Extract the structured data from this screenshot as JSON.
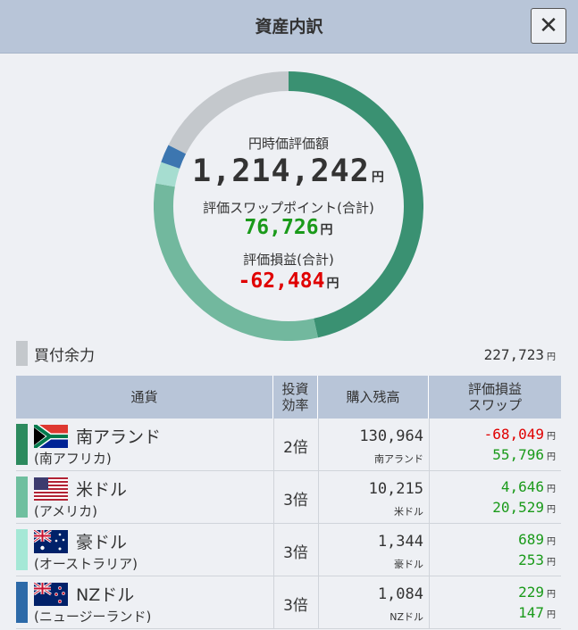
{
  "header": {
    "title": "資産内訳",
    "close_label": "✕"
  },
  "summary": {
    "valuation_label": "円時価評価額",
    "valuation_value": "1,214,242",
    "swap_label": "評価スワップポイント(合計)",
    "swap_value": "76,726",
    "pl_label": "評価損益(合計)",
    "pl_value": "-62,484",
    "unit": "円"
  },
  "chart_data": {
    "type": "pie",
    "categories": [
      "南アランド",
      "米ドル",
      "豪ドル",
      "NZドル",
      "買付余力"
    ],
    "values": [
      46.5,
      31.2,
      2.6,
      2.2,
      17.5
    ],
    "colors": [
      "#3a9172",
      "#72b89e",
      "#a6ddd0",
      "#3c76b0",
      "#c4c8cc"
    ]
  },
  "buying_power": {
    "label": "買付余力",
    "value": "227,723",
    "unit": "円"
  },
  "table": {
    "headers": {
      "currency": "通貨",
      "leverage_1": "投資",
      "leverage_2": "効率",
      "balance": "購入残高",
      "pl_1": "評価損益",
      "pl_2": "スワップ"
    },
    "rows": [
      {
        "color": "#2c8a5e",
        "flag": "za-flag-icon",
        "name": "南アランド",
        "country": "(南アフリカ)",
        "leverage": "2倍",
        "balance": "130,964",
        "balance_unit": "南アランド",
        "pl": "-68,049",
        "swap": "55,796",
        "unit": "円"
      },
      {
        "color": "#6fbf9f",
        "flag": "us-flag-icon",
        "name": "米ドル",
        "country": "(アメリカ)",
        "leverage": "3倍",
        "balance": "10,215",
        "balance_unit": "米ドル",
        "pl": "4,646",
        "swap": "20,529",
        "unit": "円"
      },
      {
        "color": "#a5e8d6",
        "flag": "au-flag-icon",
        "name": "豪ドル",
        "country": "(オーストラリア)",
        "leverage": "3倍",
        "balance": "1,344",
        "balance_unit": "豪ドル",
        "pl": "689",
        "swap": "253",
        "unit": "円"
      },
      {
        "color": "#2d6aa8",
        "flag": "nz-flag-icon",
        "name": "NZドル",
        "country": "(ニュージーランド)",
        "leverage": "3倍",
        "balance": "1,084",
        "balance_unit": "NZドル",
        "pl": "229",
        "swap": "147",
        "unit": "円"
      }
    ]
  }
}
